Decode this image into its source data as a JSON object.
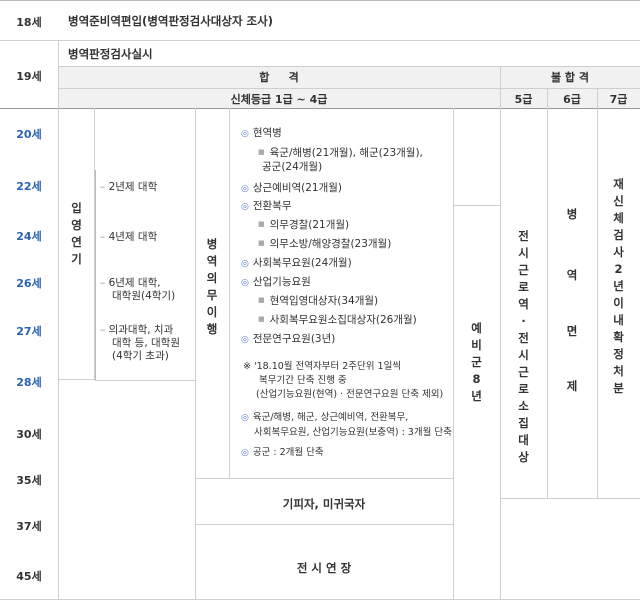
{
  "ages": {
    "a18": "18세",
    "a19": "19세",
    "a20": "20세",
    "a22": "22세",
    "a24": "24세",
    "a26": "26세",
    "a27": "27세",
    "a28": "28세",
    "a30": "30세",
    "a35": "35세",
    "a37": "37세",
    "a45": "45세"
  },
  "row18": {
    "text": "병역준비역편입(병역판정검사대상자 조사)"
  },
  "row19": {
    "title": "병역판정검사실시",
    "pass": "합     격",
    "fail": "불 합 격",
    "grade_pass": "신체등급 1급 ~ 4급",
    "grade5": "5급",
    "grade6": "6급",
    "grade7": "7급"
  },
  "enlist_delay": [
    "입",
    "영",
    "연",
    "기"
  ],
  "schools": {
    "s1": "2년제 대학",
    "s2": "4년제 대학",
    "s3a": "6년제 대학,",
    "s3b": "대학원(4학기)",
    "s4a": "의과대학, 치과",
    "s4b": "대학 등, 대학원",
    "s4c": "(4학기 초과)"
  },
  "duty_perform": [
    "병",
    "역",
    "의",
    "무",
    "이",
    "행"
  ],
  "duties": {
    "active": "현역병",
    "active_sub1": "육군/해병(21개월), 해군(23개월),",
    "active_sub2": "공군(24개월)",
    "reserve": "상근예비역(21개월)",
    "conversion": "전환복무",
    "conv_sub1": "의무경찰(21개월)",
    "conv_sub2": "의무소방/해양경찰(23개월)",
    "social": "사회복무요원(24개월)",
    "industrial": "산업기능요원",
    "ind_sub1": "현역입영대상자(34개월)",
    "ind_sub2": "사회복무요원소집대상자(26개월)",
    "research": "전문연구요원(3년)",
    "note1a": "※ '18.10월 전역자부터 2주단위 1일씩",
    "note1b": "복무기간 단축 진행 중",
    "note1c": "(산업기능요원(현역) · 전문연구요원 단축 제외)",
    "note2a": "육군/해병, 해군, 상근예비역, 전환복무,",
    "note2b": "사회복무요원, 산업기능요원(보충역) : 3개월 단축",
    "note3": "공군 : 2개월 단축"
  },
  "reserve8": [
    "예",
    "비",
    "군",
    "8",
    "년"
  ],
  "wartime5": [
    "전",
    "시",
    "근",
    "로",
    "역",
    "·",
    "전",
    "시",
    "근",
    "로",
    "소",
    "집",
    "대",
    "상"
  ],
  "grade6_text": [
    "병",
    "역",
    "면",
    "제"
  ],
  "grade7_text": [
    "재",
    "신",
    "체",
    "검",
    "사",
    "2",
    "년",
    "이",
    "내",
    "확",
    "정",
    "처",
    "분"
  ],
  "evader": "기피자, 미귀국자",
  "wartime_ext": "전 시 연 장",
  "colors": {
    "age_blue": "#2b62b4",
    "bullet": "#5b7fc9",
    "gray_bg": "#f1f1f1",
    "line": "#cfcfcf"
  }
}
